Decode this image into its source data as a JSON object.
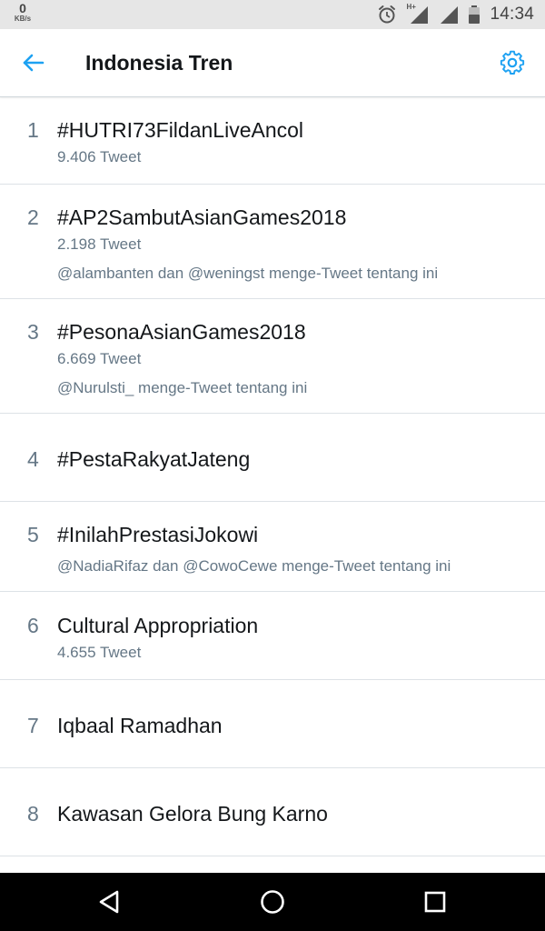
{
  "status_bar": {
    "net_speed_value": "0",
    "net_speed_unit": "KB/s",
    "network_type": "H+",
    "time": "14:34",
    "icons": [
      "alarm-icon",
      "signal-icon",
      "signal-icon",
      "battery-icon"
    ]
  },
  "header": {
    "title": "Indonesia Tren",
    "back_icon": "arrow-left-icon",
    "settings_icon": "gear-icon"
  },
  "colors": {
    "accent": "#1da1f2",
    "primary_text": "#14171a",
    "secondary_text": "#657786",
    "divider": "#dde2e6",
    "status_bar_bg": "#e6e6e6",
    "nav_bar_bg": "#000000"
  },
  "trends": [
    {
      "rank": "1",
      "name": "#HUTRI73FildanLiveAncol",
      "count": "9.406 Tweet",
      "context": ""
    },
    {
      "rank": "2",
      "name": "#AP2SambutAsianGames2018",
      "count": "2.198 Tweet",
      "context": "@alambanten dan @weningst menge-Tweet tentang ini"
    },
    {
      "rank": "3",
      "name": "#PesonaAsianGames2018",
      "count": "6.669 Tweet",
      "context": "@Nurulsti_ menge-Tweet tentang ini"
    },
    {
      "rank": "4",
      "name": "#PestaRakyatJateng",
      "count": "",
      "context": ""
    },
    {
      "rank": "5",
      "name": "#InilahPrestasiJokowi",
      "count": "",
      "context": "@NadiaRifaz dan @CowoCewe menge-Tweet tentang ini"
    },
    {
      "rank": "6",
      "name": "Cultural Appropriation",
      "count": "4.655 Tweet",
      "context": ""
    },
    {
      "rank": "7",
      "name": "Iqbaal Ramadhan",
      "count": "",
      "context": ""
    },
    {
      "rank": "8",
      "name": "Kawasan Gelora Bung Karno",
      "count": "",
      "context": ""
    }
  ],
  "nav_bar": {
    "icons": [
      "back-triangle-icon",
      "home-circle-icon",
      "recents-square-icon"
    ]
  }
}
